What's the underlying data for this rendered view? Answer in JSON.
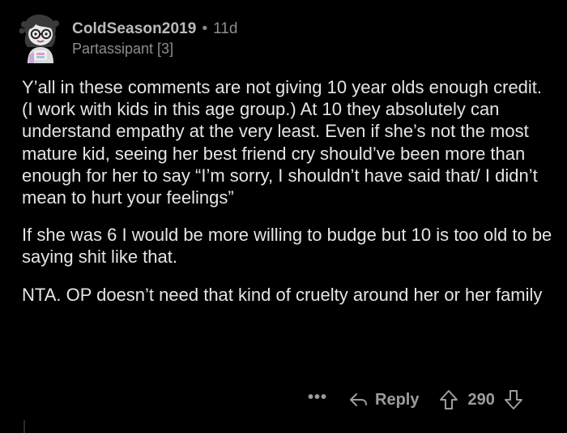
{
  "comment": {
    "username": "ColdSeason2019",
    "separator": "•",
    "age": "11d",
    "flair": "Partassipant [3]",
    "paragraphs": [
      "Y’all in these comments are not giving 10 year olds enough credit. (I work with kids in this age group.) At 10 they absolutely can understand empathy at the very least. Even if she’s not the most mature kid, seeing her best friend cry should’ve been more than enough for her to say “I’m sorry, I shouldn’t have said that/ I didn’t mean to hurt your feelings”",
      "If she was 6 I would be more willing to budge but 10 is too old to be saying shit like that.",
      "NTA. OP doesn’t need that kind of cruelty around her or her family"
    ],
    "actions": {
      "more_label": "•••",
      "reply_label": "Reply",
      "score": "290"
    }
  },
  "icons": {
    "avatar": "avatar-icon",
    "reply": "reply-arrow-icon",
    "upvote": "upvote-arrow-icon",
    "downvote": "downvote-arrow-icon"
  },
  "colors": {
    "background": "#000000",
    "text": "#e3e5e7",
    "muted": "#8a8d90"
  }
}
